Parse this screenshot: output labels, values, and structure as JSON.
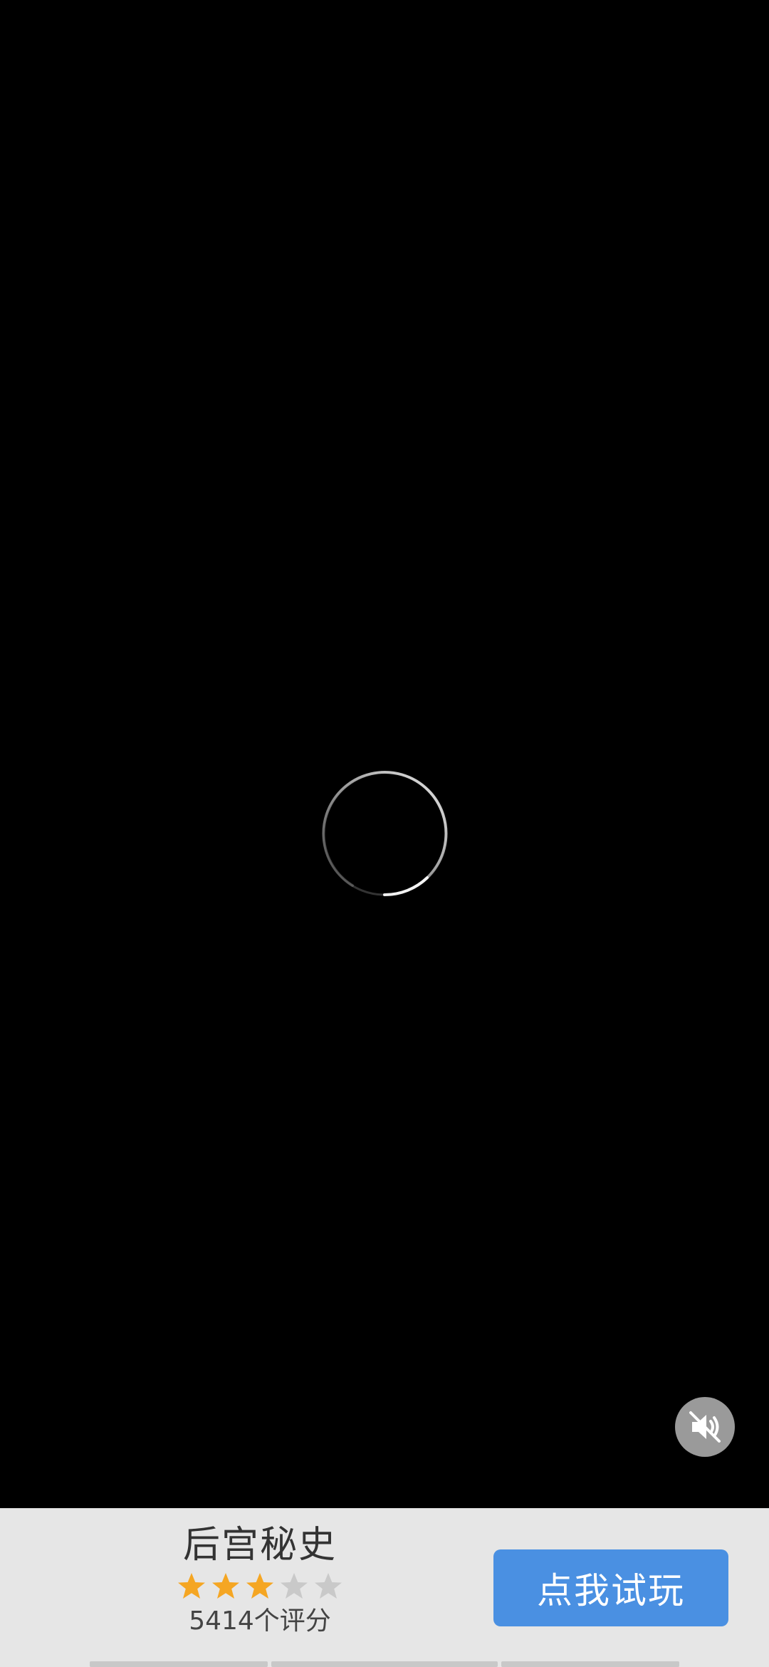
{
  "app": {
    "title": "后宫秘史",
    "rating_value": 3,
    "rating_max": 5,
    "rating_count_text": "5414个评分",
    "cta_label": "点我试玩"
  },
  "icons": {
    "mute": "speaker-muted-icon",
    "loading": "loading-spinner-icon",
    "star": "star-icon"
  },
  "colors": {
    "star_filled": "#f5a623",
    "star_empty": "#c9c9c9",
    "cta_background": "#4a90e2",
    "bottom_bar": "#e6e6e6"
  }
}
